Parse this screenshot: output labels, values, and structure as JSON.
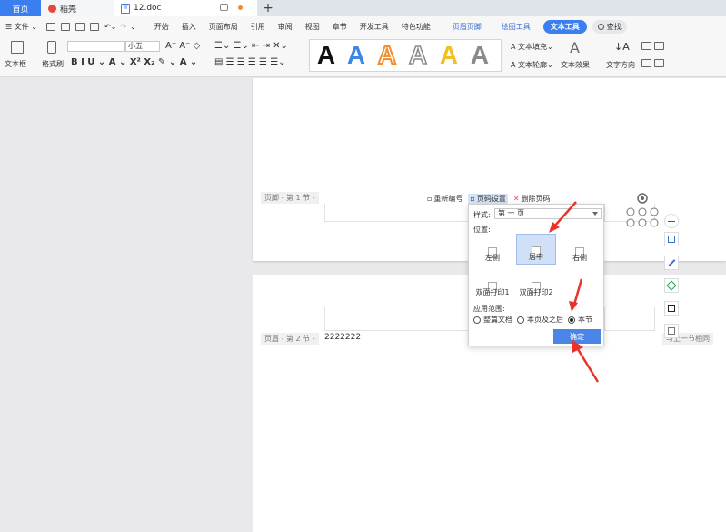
{
  "tabs": {
    "home": "首页",
    "daoke": "稻壳",
    "doc": "12.doc",
    "doc_badge": "W"
  },
  "menu": {
    "file": "文件",
    "items": [
      "开始",
      "插入",
      "页面布局",
      "引用",
      "审阅",
      "视图",
      "章节",
      "开发工具",
      "特色功能"
    ],
    "header_footer": "页眉页脚",
    "draw_tools": "绘图工具",
    "text_tools": "文本工具",
    "search": "查找"
  },
  "toolbar": {
    "textbox_label": "文本框",
    "format_brush_label": "格式刷",
    "font_size": "小五",
    "text_fill": "文本填充",
    "text_outline": "文本轮廓",
    "text_effect": "文本效果",
    "text_direction": "文字方向",
    "wordart_letter": "A",
    "wordart_colors": [
      "#111111",
      "#3c86e6",
      "#f09030",
      "#ffffff",
      "#f0c020",
      "#8a8a8a"
    ]
  },
  "document": {
    "footer_label": "页脚 - 第 1 节 -",
    "header_label": "页眉 - 第 2 节 -",
    "header_text": "2222222",
    "same_as_prev": "与上一节相同"
  },
  "page_number_toolbar": {
    "renumber": "重新编号",
    "page_setup": "页码设置",
    "delete": "删除页码"
  },
  "popup": {
    "style_label": "样式:",
    "style_value": "第 一 页",
    "position_label": "位置:",
    "positions": [
      "左侧",
      "居中",
      "右侧",
      "双面打印1",
      "双面打印2"
    ],
    "range_label": "应用范围:",
    "ranges": [
      "整篇文档",
      "本页及之后",
      "本节"
    ],
    "ok": "确定"
  },
  "colors": {
    "accent": "#3b7ef0",
    "arrow": "#e8332a"
  }
}
